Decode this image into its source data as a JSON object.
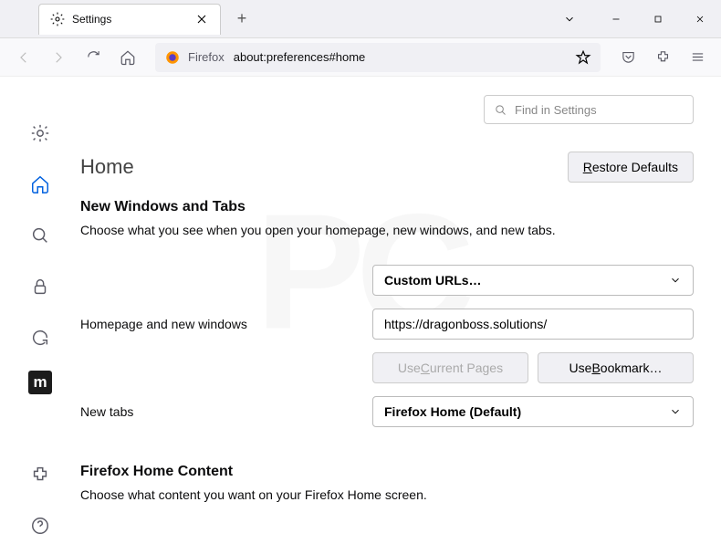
{
  "tab": {
    "label": "Settings"
  },
  "urlbar": {
    "prefix": "Firefox",
    "url": "about:preferences#home"
  },
  "search": {
    "placeholder": "Find in Settings"
  },
  "page": {
    "title": "Home"
  },
  "buttons": {
    "restore": "Restore Defaults",
    "useCurrent": "Use Current Pages",
    "useBookmark": "Use Bookmark…"
  },
  "sections": {
    "newWindows": {
      "title": "New Windows and Tabs",
      "desc": "Choose what you see when you open your homepage, new windows, and new tabs."
    },
    "homeContent": {
      "title": "Firefox Home Content",
      "desc": "Choose what content you want on your Firefox Home screen."
    }
  },
  "rows": {
    "homepage": {
      "label": "Homepage and new windows",
      "select": "Custom URLs…",
      "url": "https://dragonboss.solutions/"
    },
    "newtabs": {
      "label": "New tabs",
      "select": "Firefox Home (Default)"
    }
  }
}
